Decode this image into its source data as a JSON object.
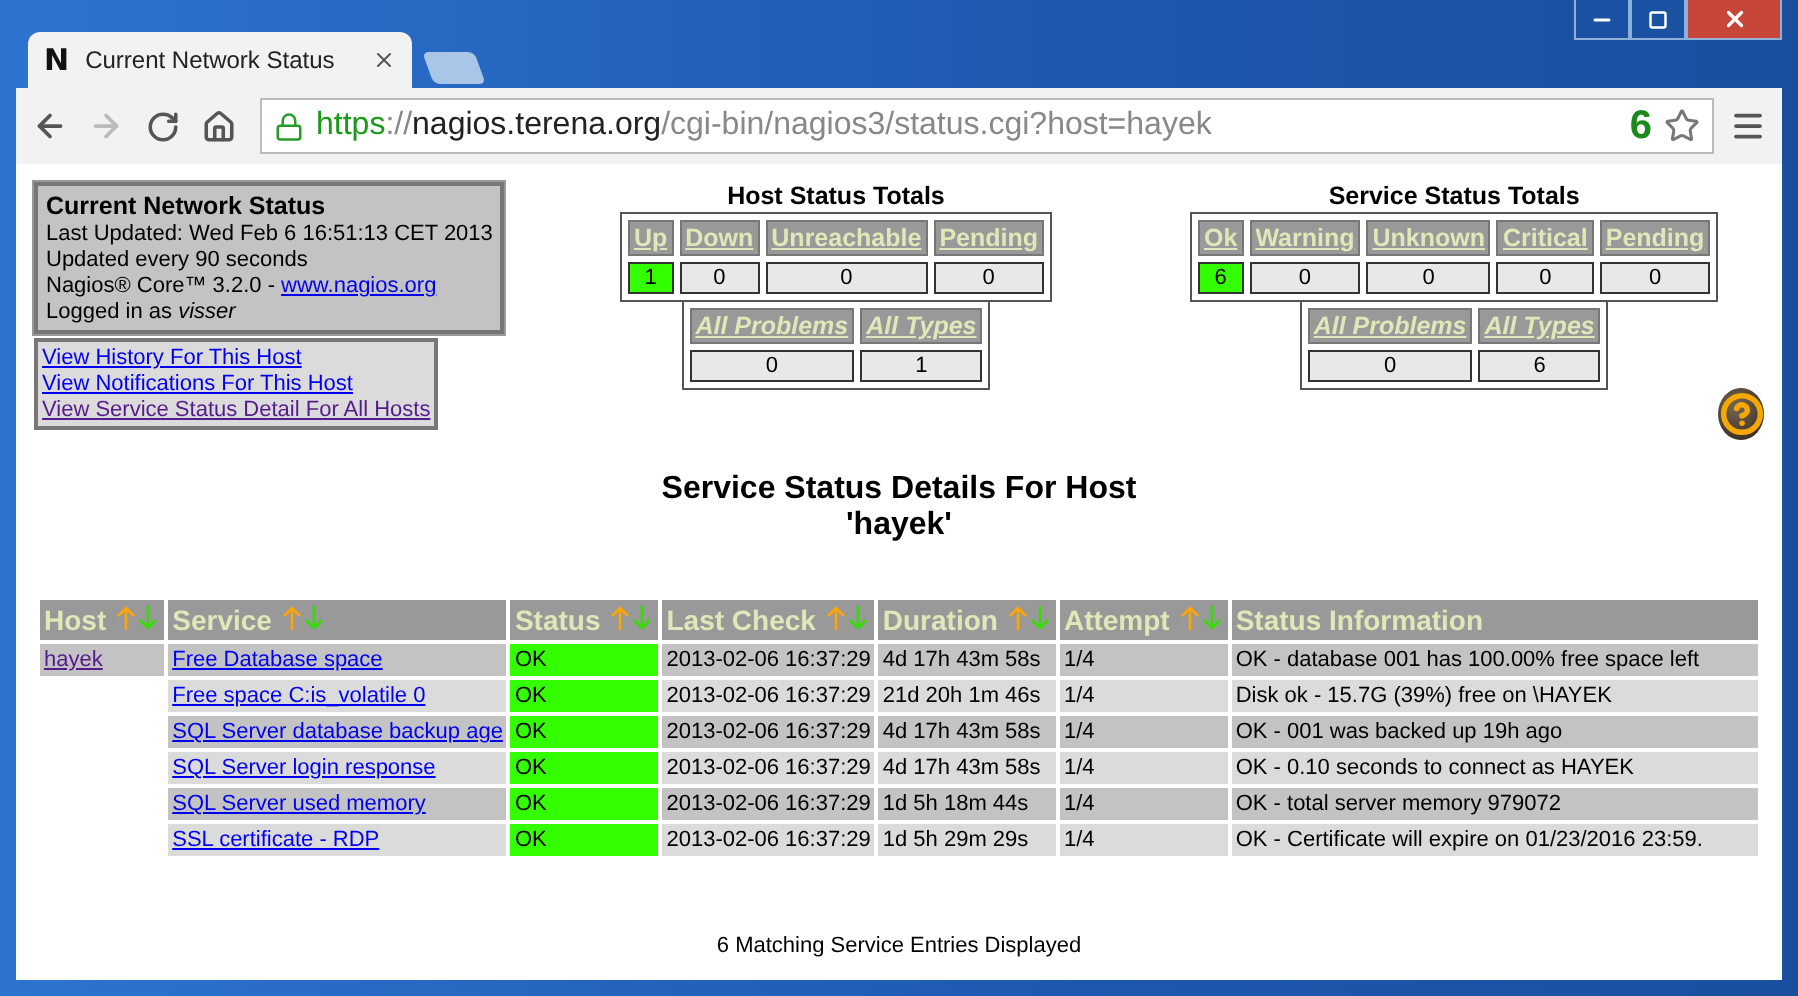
{
  "browser": {
    "tab": {
      "icon_letter": "N",
      "title": "Current Network Status"
    },
    "address": {
      "scheme": "https",
      "separator": "://",
      "host": "nagios.terena.org",
      "path": "/cgi-bin/nagios3/status.cgi?host=hayek"
    },
    "extension_badge": "6",
    "forward_enabled": false
  },
  "info_box": {
    "title": "Current Network Status",
    "lines": [
      "Last Updated: Wed Feb 6 16:51:13 CET 2013",
      "Updated every 90 seconds"
    ],
    "version_text": "Nagios® Core™ 3.2.0 - ",
    "version_link": "www.nagios.org",
    "logged_in": "Logged in as *visser*"
  },
  "links": [
    {
      "label": "View History For This Host",
      "visited": false
    },
    {
      "label": "View Notifications For This Host",
      "visited": false
    },
    {
      "label": "View Service Status Detail For All Hosts",
      "visited": true
    }
  ],
  "host_totals": {
    "title": "Host Status Totals",
    "states": [
      {
        "label": "Up",
        "count": "1",
        "highlight": true
      },
      {
        "label": "Down",
        "count": "0",
        "highlight": false
      },
      {
        "label": "Unreachable",
        "count": "0",
        "highlight": false
      },
      {
        "label": "Pending",
        "count": "0",
        "highlight": false
      }
    ],
    "summary": [
      {
        "label": "All Problems",
        "count": "0"
      },
      {
        "label": "All Types",
        "count": "1"
      }
    ]
  },
  "service_totals": {
    "title": "Service Status Totals",
    "states": [
      {
        "label": "Ok",
        "count": "6",
        "highlight": true
      },
      {
        "label": "Warning",
        "count": "0",
        "highlight": false
      },
      {
        "label": "Unknown",
        "count": "0",
        "highlight": false
      },
      {
        "label": "Critical",
        "count": "0",
        "highlight": false
      },
      {
        "label": "Pending",
        "count": "0",
        "highlight": false
      }
    ],
    "summary": [
      {
        "label": "All Problems",
        "count": "0"
      },
      {
        "label": "All Types",
        "count": "6"
      }
    ]
  },
  "details": {
    "title": "Service Status Details For Host",
    "host_line": "'hayek'",
    "columns": [
      {
        "label": "Host",
        "sortable": true
      },
      {
        "label": "Service",
        "sortable": true
      },
      {
        "label": "Status",
        "sortable": true
      },
      {
        "label": "Last Check",
        "sortable": true
      },
      {
        "label": "Duration",
        "sortable": true
      },
      {
        "label": "Attempt",
        "sortable": true
      },
      {
        "label": "Status Information",
        "sortable": false
      }
    ],
    "rows": [
      {
        "host": "hayek",
        "service": "Free Database space",
        "status": "OK",
        "color": "#33ff00",
        "last_check": "2013-02-06 16:37:29",
        "duration": "4d 17h 43m 58s",
        "attempt": "1/4",
        "info": "OK - database 001 has 100.00% free space left"
      },
      {
        "service": "Free space C:is_volatile 0",
        "status": "OK",
        "color": "#33ff00",
        "last_check": "2013-02-06 16:37:29",
        "duration": "21d 20h 1m 46s",
        "attempt": "1/4",
        "info": "Disk ok - 15.7G (39%) free on \\HAYEK"
      },
      {
        "service": "SQL Server database backup age",
        "status": "OK",
        "color": "#33ff00",
        "last_check": "2013-02-06 16:37:29",
        "duration": "4d 17h 43m 58s",
        "attempt": "1/4",
        "info": "OK - 001 was backed up 19h ago"
      },
      {
        "service": "SQL Server login response",
        "status": "OK",
        "color": "#33ff00",
        "last_check": "2013-02-06 16:37:29",
        "duration": "4d 17h 43m 58s",
        "attempt": "1/4",
        "info": "OK - 0.10 seconds to connect as HAYEK"
      },
      {
        "service": "SQL Server used memory",
        "status": "OK",
        "color": "#33ff00",
        "last_check": "2013-02-06 16:37:29",
        "duration": "1d 5h 18m 44s",
        "attempt": "1/4",
        "info": "OK - total server memory 979072"
      },
      {
        "service": "SSL certificate - RDP",
        "status": "OK",
        "color": "#33ff00",
        "last_check": "2013-02-06 16:37:29",
        "duration": "1d 5h 29m 29s",
        "attempt": "1/4",
        "info": "OK - Certificate will expire on 01/23/2016 23:59."
      }
    ],
    "footer": "6 Matching Service Entries Displayed"
  }
}
